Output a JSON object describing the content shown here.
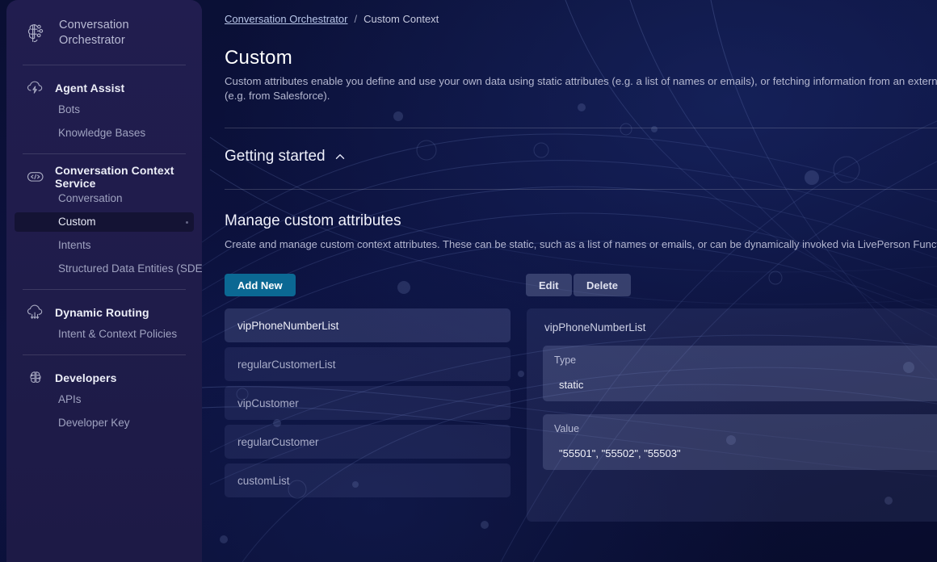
{
  "brand": {
    "line1": "Conversation",
    "line2": "Orchestrator",
    "icon": "brain-network-icon"
  },
  "sidebar": {
    "groups": [
      {
        "icon": "cloud-bolt-icon",
        "label": "Agent Assist",
        "items": [
          {
            "label": "Bots",
            "active": false
          },
          {
            "label": "Knowledge Bases",
            "active": false
          }
        ]
      },
      {
        "icon": "code-brackets-icon",
        "label": "Conversation Context Service",
        "items": [
          {
            "label": "Conversation",
            "active": false
          },
          {
            "label": "Custom",
            "active": true
          },
          {
            "label": "Intents",
            "active": false
          },
          {
            "label": "Structured Data Entities (SDE)",
            "active": false
          }
        ]
      },
      {
        "icon": "cloud-routing-icon",
        "label": "Dynamic Routing",
        "items": [
          {
            "label": "Intent & Context Policies",
            "active": false
          }
        ]
      },
      {
        "icon": "brain-circuit-icon",
        "label": "Developers",
        "items": [
          {
            "label": "APIs",
            "active": false
          },
          {
            "label": "Developer Key",
            "active": false
          }
        ]
      }
    ]
  },
  "breadcrumb": {
    "root": "Conversation Orchestrator",
    "separator": "/",
    "current": "Custom Context"
  },
  "page": {
    "title": "Custom",
    "description": "Custom attributes enable you define and use your own data using static attributes (e.g. a list of names or emails), or fetching information from an external source using LivePerson Functions (e.g. from Salesforce)."
  },
  "getting_started": {
    "label": "Getting started",
    "chevron": "chevron-up-icon",
    "expanded": true
  },
  "manage": {
    "title": "Manage custom attributes",
    "description": "Create and manage custom context attributes. These can be static, such as a list of names or emails, or can be dynamically invoked via LivePerson Functions."
  },
  "toolbar": {
    "add_new_label": "Add New",
    "edit_label": "Edit",
    "delete_label": "Delete",
    "primary_color": "#0b6893"
  },
  "attributes": [
    {
      "name": "vipPhoneNumberList",
      "selected": true
    },
    {
      "name": "regularCustomerList",
      "selected": false
    },
    {
      "name": "vipCustomer",
      "selected": false
    },
    {
      "name": "regularCustomer",
      "selected": false
    },
    {
      "name": "customList",
      "selected": false
    }
  ],
  "detail": {
    "title": "vipPhoneNumberList",
    "fields": [
      {
        "label": "Type",
        "value": "static"
      },
      {
        "label": "Value",
        "value": "\"55501\", \"55502\", \"55503\""
      }
    ]
  }
}
